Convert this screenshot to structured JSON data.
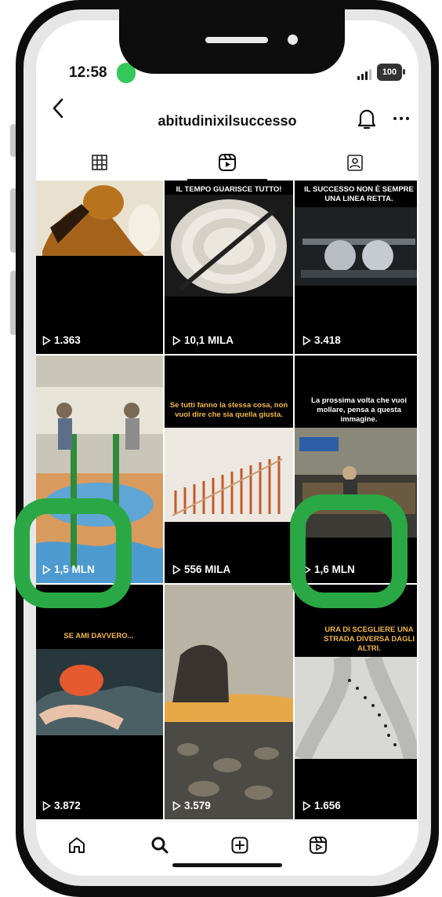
{
  "status_bar": {
    "time": "12:58",
    "battery": "100"
  },
  "header": {
    "title": "abitudinixilsuccesso"
  },
  "tabs": [
    {
      "icon": "grid-icon",
      "active": false
    },
    {
      "icon": "reels-icon",
      "active": true
    },
    {
      "icon": "tagged-icon",
      "active": false
    }
  ],
  "reels": [
    {
      "views": "1.363",
      "caption": ""
    },
    {
      "views": "10,1 MILA",
      "caption": "IL TEMPO GUARISCE TUTTO!"
    },
    {
      "views": "3.418",
      "caption": "IL SUCCESSO NON È SEMPRE UNA LINEA RETTA."
    },
    {
      "views": "1,5 MLN",
      "caption": ""
    },
    {
      "views": "556 MILA",
      "caption": "Se tutti fanno la stessa cosa, non vuol dire che sia quella giusta."
    },
    {
      "views": "1,6 MLN",
      "caption": "La prossima volta che vuoi mollare, pensa a questa immagine."
    },
    {
      "views": "3.872",
      "caption": "SE AMI DAVVERO..."
    },
    {
      "views": "3.579",
      "caption": ""
    },
    {
      "views": "1.656",
      "caption": "URA DI SCEGLIERE UNA STRADA DIVERSA DAGLI ALTRI."
    }
  ],
  "bottom_nav": [
    "home-icon",
    "search-icon",
    "create-icon",
    "reels-icon"
  ],
  "colors": {
    "highlight": "#2aa845",
    "caption_accent": "#f2b84b"
  }
}
